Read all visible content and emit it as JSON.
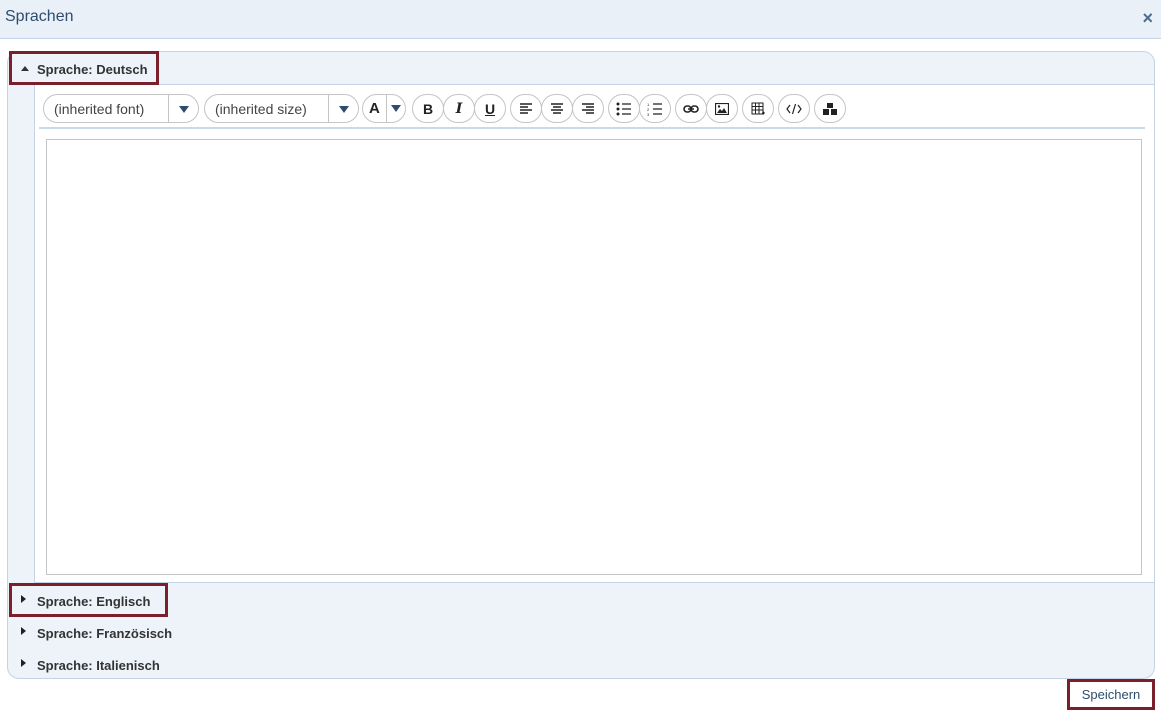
{
  "dialog": {
    "title": "Sprachen",
    "close_label": "×"
  },
  "accordion": {
    "sections": [
      {
        "label": "Sprache: Deutsch",
        "expanded": true
      },
      {
        "label": "Sprache: Englisch",
        "expanded": false
      },
      {
        "label": "Sprache: Französisch",
        "expanded": false
      },
      {
        "label": "Sprache: Italienisch",
        "expanded": false
      }
    ]
  },
  "toolbar": {
    "font_select": "(inherited font)",
    "size_select": "(inherited size)",
    "color_label": "A",
    "bold_label": "B",
    "italic_label": "I",
    "underline_label": "U"
  },
  "footer": {
    "save_label": "Speichern"
  },
  "colors": {
    "highlight": "#7a1f2b",
    "accent": "#2e4d6e",
    "panel_bg": "#eef3f9"
  }
}
